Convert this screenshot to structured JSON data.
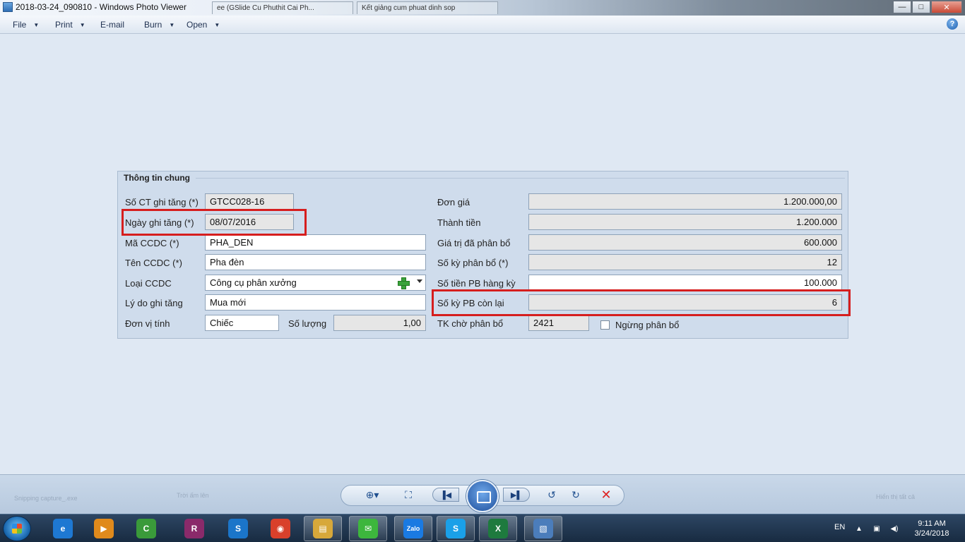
{
  "window": {
    "title": "2018-03-24_090810 - Windows Photo Viewer",
    "bg_tabs": [
      "ee (GSlide Cu Phuthit Cai Ph...",
      "Kết giảng cum phuat dinh sop"
    ],
    "minimize": "—",
    "maximize": "□",
    "close": "✕"
  },
  "menu": {
    "items": [
      "File",
      "Print",
      "E-mail",
      "Burn",
      "Open"
    ],
    "help": "?"
  },
  "form": {
    "group_title": "Thông tin chung",
    "left": {
      "so_ct_label": "Số CT ghi tăng (*)",
      "so_ct_value": "GTCC028-16",
      "ngay_label": "Ngày ghi tăng (*)",
      "ngay_value": "08/07/2016",
      "ma_label": "Mã CCDC (*)",
      "ma_value": "PHA_DEN",
      "ten_label": "Tên CCDC (*)",
      "ten_value": "Pha đèn",
      "loai_label": "Loại CCDC",
      "loai_value": "Công cụ phân xưởng",
      "lydo_label": "Lý do ghi tăng",
      "lydo_value": "Mua mới",
      "dvt_label": "Đơn vị tính",
      "dvt_value": "Chiếc",
      "soluong_label": "Số lượng",
      "soluong_value": "1,00"
    },
    "right": {
      "dongia_label": "Đơn giá",
      "dongia_value": "1.200.000,00",
      "thanhtien_label": "Thành tiền",
      "thanhtien_value": "1.200.000",
      "gtpb_label": "Giá trị đã phân bổ",
      "gtpb_value": "600.000",
      "sokypb_label": "Số kỳ phân bổ (*)",
      "sokypb_value": "12",
      "sotienpb_label": "Số tiền PB hàng kỳ",
      "sotienpb_value": "100.000",
      "sokyconlai_label": "Số kỳ PB còn lại",
      "sokyconlai_value": "6",
      "tk_label": "TK chờ phân bổ",
      "tk_value": "2421",
      "ngung_label": "Ngừng phân bổ"
    },
    "highlight_color": "#d61e1e"
  },
  "viewer": {
    "ghost_items": [
      "Snipping capture_.exe",
      "Trời ấm lên",
      "Hiển thị tất cả"
    ]
  },
  "taskbar": {
    "apps": [
      {
        "name": "ie",
        "glyph": "e",
        "color": "#1e78d2"
      },
      {
        "name": "media",
        "glyph": "▶",
        "color": "#e08a1c"
      },
      {
        "name": "coccoc",
        "glyph": "C",
        "color": "#3a9a3a"
      },
      {
        "name": "winrar",
        "glyph": "R",
        "color": "#8a2a6a"
      },
      {
        "name": "sforum",
        "glyph": "S",
        "color": "#1b75c9"
      },
      {
        "name": "chrome",
        "glyph": "◉",
        "color": "#d9402b"
      },
      {
        "name": "explorer",
        "glyph": "▤",
        "color": "#d7a83a"
      },
      {
        "name": "wechat",
        "glyph": "✉",
        "color": "#3db63d"
      },
      {
        "name": "zalo",
        "glyph": "Zalo",
        "color": "#1a7ae2"
      },
      {
        "name": "skype",
        "glyph": "S",
        "color": "#1aa0e8"
      },
      {
        "name": "excel",
        "glyph": "X",
        "color": "#1e7a3e"
      },
      {
        "name": "photoviewer",
        "glyph": "▧",
        "color": "#4b7dbb"
      }
    ],
    "lang": "EN",
    "time": "9:11 AM",
    "date": "3/24/2018"
  }
}
